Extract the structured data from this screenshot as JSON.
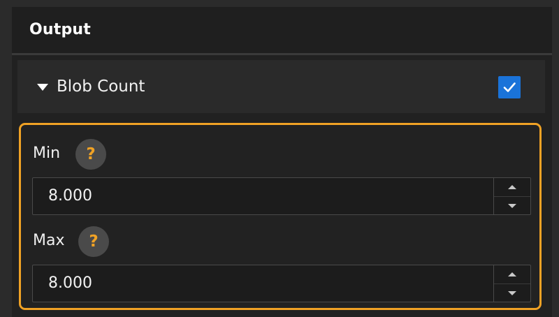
{
  "section": {
    "title": "Output"
  },
  "group": {
    "title": "Blob Count",
    "enabled": true,
    "expanded": true
  },
  "fields": [
    {
      "label": "Min",
      "value": "8.000",
      "help": "?"
    },
    {
      "label": "Max",
      "value": "8.000",
      "help": "?"
    }
  ],
  "colors": {
    "accent": "#f0a225",
    "checkbox": "#1a73d9",
    "panel": "#212121",
    "input_bg": "#1c1c1c"
  },
  "icons": {
    "expand": "caret-down-icon",
    "check": "checkmark-icon",
    "help": "question-icon",
    "increment": "chevron-up-icon",
    "decrement": "chevron-down-icon"
  }
}
